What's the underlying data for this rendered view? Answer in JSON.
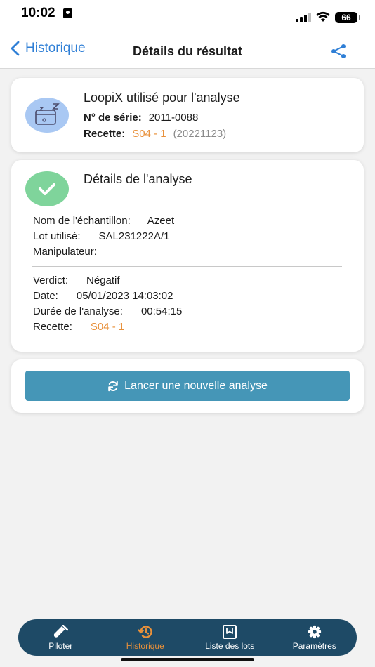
{
  "status_bar": {
    "time": "10:02",
    "battery": "66"
  },
  "nav": {
    "back_label": "Historique",
    "title": "Détails du résultat"
  },
  "device_card": {
    "title": "LoopiX utilisé pour l'analyse",
    "serial_label": "N° de série:",
    "serial_value": "2011-0088",
    "recipe_label": "Recette:",
    "recipe_value": "S04 - 1",
    "recipe_date": "(20221123)"
  },
  "analysis_card": {
    "title": "Détails de l'analyse",
    "sample_label": "Nom de l'échantillon:",
    "sample_value": "Azeet",
    "lot_label": "Lot utilisé:",
    "lot_value": "SAL231222A/1",
    "operator_label": "Manipulateur:",
    "operator_value": "",
    "verdict_label": "Verdict:",
    "verdict_value": "Négatif",
    "date_label": "Date:",
    "date_value": "05/01/2023 14:03:02",
    "duration_label": "Durée de l'analyse:",
    "duration_value": "00:54:15",
    "recipe_label": "Recette:",
    "recipe_value": "S04 - 1"
  },
  "action": {
    "new_analysis_label": "Lancer une nouvelle analyse"
  },
  "tabs": [
    {
      "label": "Piloter",
      "icon": "test-tube-icon",
      "active": false
    },
    {
      "label": "Historique",
      "icon": "history-icon",
      "active": true
    },
    {
      "label": "Liste des lots",
      "icon": "lots-list-icon",
      "active": false
    },
    {
      "label": "Paramètres",
      "icon": "gear-icon",
      "active": false
    }
  ],
  "colors": {
    "accent_blue": "#2f7fd6",
    "orange": "#e8903a",
    "button": "#4596b7",
    "tab_bar": "#1e4a66",
    "success": "#7fd49b"
  }
}
